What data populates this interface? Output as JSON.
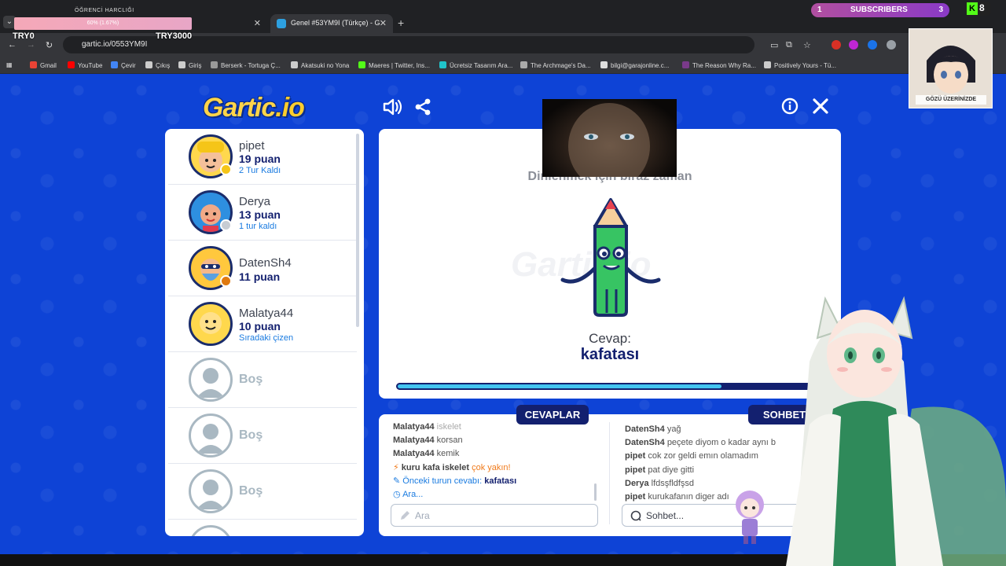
{
  "browser": {
    "overlay_top": "ÖĞRENCİ HARCLIĞI",
    "progress_text": "60% (1.67%)",
    "try_left": "TRY0",
    "try_right": "TRY3000",
    "active_tab_title": "Genel #53YM9I (Türkçe) - G",
    "url": "gartic.io/0553YM9I",
    "bookmarks": [
      {
        "label": "Gmail",
        "color": "#ea4335"
      },
      {
        "label": "YouTube",
        "color": "#ff0000"
      },
      {
        "label": "Çevir",
        "color": "#4285f4"
      },
      {
        "label": "Çıkış",
        "color": "#cccccc"
      },
      {
        "label": "Giriş",
        "color": "#cccccc"
      },
      {
        "label": "Berserk - Tortuga Ç...",
        "color": "#999999"
      },
      {
        "label": "Akatsuki no Yona",
        "color": "#cccccc"
      },
      {
        "label": "Maeres | Twitter, Ins...",
        "color": "#53fc18"
      },
      {
        "label": "Ücretsiz Tasarım Ara...",
        "color": "#20c4cb"
      },
      {
        "label": "The Archmage's Da...",
        "color": "#aaaaaa"
      },
      {
        "label": "bilgi@garajonline.c...",
        "color": "#dddddd"
      },
      {
        "label": "The Reason Why Ra...",
        "color": "#7a3a8a"
      },
      {
        "label": "Positively Yours - Tü...",
        "color": "#cccccc"
      }
    ]
  },
  "stream_overlay": {
    "subs_left": "1",
    "subs_label": "SUBSCRIBERS",
    "subs_right": "3",
    "kick_count": "8",
    "anime_logo_text": "GÖZÜ ÜZERİNİZDE"
  },
  "game": {
    "logo": "Gartic",
    "logo_suffix": ".io",
    "players": [
      {
        "name": "pipet",
        "score": "19 puan",
        "note": "2 Tur Kaldı",
        "avatar_color": "#ffd84d",
        "dot_color": "#f5c518"
      },
      {
        "name": "Derya",
        "score": "13 puan",
        "note": "1 tur kaldı",
        "avatar_color": "#ff8a65",
        "dot_color": "#c7ccd3"
      },
      {
        "name": "DatenSh4",
        "score": "11 puan",
        "note": "",
        "avatar_color": "#ffc83d",
        "dot_color": "#e07a10"
      },
      {
        "name": "Malatya44",
        "score": "10 puan",
        "note": "Sıradaki çizen",
        "avatar_color": "#ffd84d",
        "dot_color": ""
      }
    ],
    "empty_slot_label": "Boş",
    "empty_slots": 3,
    "wait_message": "Dinlenmek için biraz zaman",
    "watermark": "Gartic.io",
    "answer_label": "Cevap:",
    "answer_value": "kafatası",
    "timer_progress": 0.765,
    "answers_tab": "CEVAPLAR",
    "chat_tab": "SOHBET",
    "answers": [
      {
        "user": "Malatya44",
        "text": "iskelet"
      },
      {
        "user": "Malatya44",
        "text": "korsan"
      },
      {
        "user": "Malatya44",
        "text": "kemik"
      }
    ],
    "close_hint": {
      "guess": "kuru kafa iskelet",
      "text": "çok yakın!"
    },
    "prev_answer_label": "Önceki turun cevabı:",
    "prev_answer_value": "kafatası",
    "search_link": "Ara...",
    "answer_placeholder": "Ara",
    "chat": [
      {
        "user": "DatenSh4",
        "text": "yağ"
      },
      {
        "user": "DatenSh4",
        "text": "peçete diyom o kadar aynı b"
      },
      {
        "user": "pipet",
        "text": "cok zor geldi emın olamadım"
      },
      {
        "user": "pipet",
        "text": "pat diye gitti"
      },
      {
        "user": "Derya",
        "text": "lfdsşfldfşsd"
      },
      {
        "user": "pipet",
        "text": "kurukafanın diger adı"
      }
    ],
    "chat_placeholder": "Sohbet..."
  }
}
